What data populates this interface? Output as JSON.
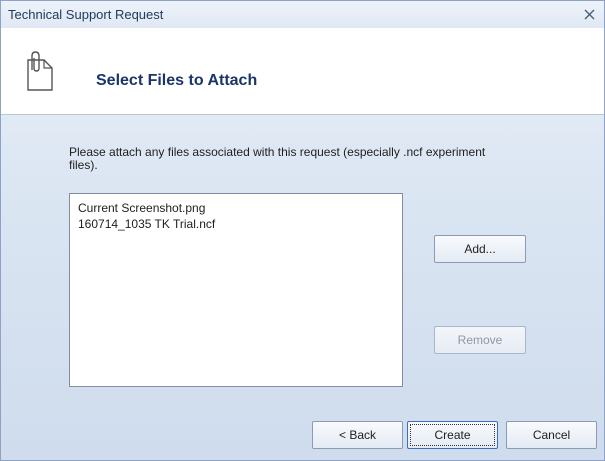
{
  "window": {
    "title": "Technical Support Request"
  },
  "header": {
    "title": "Select Files to Attach",
    "icon": "paperclip-file-icon"
  },
  "description": "Please attach any files associated with this request (especially .ncf experiment files).",
  "files": [
    "Current Screenshot.png",
    "160714_1035 TK Trial.ncf"
  ],
  "buttons": {
    "add": "Add...",
    "remove": "Remove",
    "back": "< Back",
    "create": "Create",
    "cancel": "Cancel"
  },
  "icons": {
    "close": "close-icon"
  }
}
